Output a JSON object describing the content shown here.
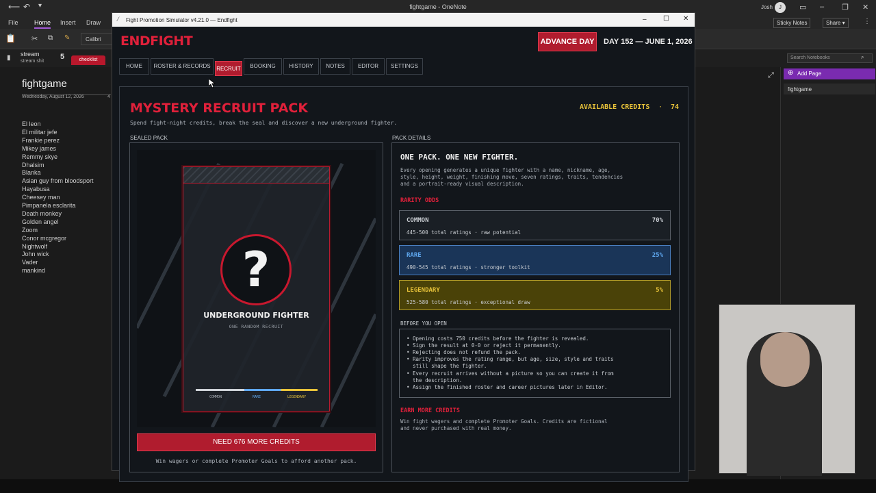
{
  "onenote": {
    "window_title": "fightgame - OneNote",
    "user": "Josh",
    "user_initial": "J",
    "tabs": [
      "File",
      "Home",
      "Insert",
      "Draw"
    ],
    "font_name": "Calibri",
    "section_label": "stream",
    "section_sub": "stream shit",
    "section_num": "5",
    "section_tab": "checklist",
    "page_title": "fightgame",
    "page_date": "Wednesday, August 12, 2026",
    "page_num": "4",
    "list_items": [
      "El leon",
      "El militar jefe",
      "Frankie perez",
      "Mikey james",
      "Remmy skye",
      "Dhalsim",
      "Blanka",
      "Asian guy from bloodsport",
      "Hayabusa",
      "Cheesey man",
      "Pimpanela esclarita",
      "Death monkey",
      "Golden angel",
      "Zoom",
      "Conor mcgregor",
      "Nightwolf",
      "John wick",
      "Vader",
      "mankind"
    ],
    "sticky_notes": "Sticky Notes",
    "share": "Share",
    "search_placeholder": "Search Notebooks",
    "add_page": "Add Page",
    "right_page": "fightgame"
  },
  "game": {
    "window_title": "Fight Promotion Simulator v4.21.0 — Endfight",
    "logo": "ENDFIGHT",
    "advance_day": "ADVANCE DAY",
    "day_label": "DAY 152 — JUNE 1, 2026",
    "nav": [
      "HOME",
      "ROSTER & RECORDS",
      "RECRUIT",
      "BOOKING",
      "HISTORY",
      "NOTES",
      "EDITOR",
      "SETTINGS"
    ],
    "page_title": "MYSTERY RECRUIT PACK",
    "page_subtitle": "Spend fight-night credits, break the seal and discover a new underground fighter.",
    "credits_label": "AVAILABLE CREDITS",
    "credits_sep": "·",
    "credits_value": "74",
    "sealed_pack_label": "SEALED PACK",
    "pack_question": "?",
    "pack_title": "UNDERGROUND FIGHTER",
    "pack_sub": "ONE RANDOM RECRUIT",
    "bar_labels": [
      "COMMON",
      "RARE",
      "LEGENDARY"
    ],
    "need_credits_btn": "NEED 676 MORE CREDITS",
    "need_note": "Win wagers or complete Promoter Goals to afford another pack.",
    "pack_details_label": "PACK DETAILS",
    "details_heading": "ONE PACK. ONE NEW FIGHTER.",
    "details_text": "Every opening generates a unique fighter with a name, nickname, age, style, height, weight, finishing move, seven ratings, traits, tendencies and a portrait-ready visual description.",
    "rarity_heading": "RARITY ODDS",
    "rarity": [
      {
        "name": "COMMON",
        "pct": "70%",
        "desc": "445-500 total ratings  ·  raw potential",
        "color": "#1a1f25",
        "text": "#c9cdd2"
      },
      {
        "name": "RARE",
        "pct": "25%",
        "desc": "490-545 total ratings  ·  stronger toolkit",
        "color": "#1a3558",
        "text": "#5fa8f0"
      },
      {
        "name": "LEGENDARY",
        "pct": "5%",
        "desc": "525-580 total ratings  ·  exceptional draw",
        "color": "#4a4208",
        "text": "#e8c33a"
      }
    ],
    "before_heading": "BEFORE YOU OPEN",
    "before_items": [
      "• Opening costs 750 credits before the fighter is revealed.",
      "• Sign the result at 0-0 or reject it permanently.",
      "• Rejecting does not refund the pack.",
      "• Rarity improves the rating range, but age, size, style and traits",
      "  still shape the fighter.",
      "• Every recruit arrives without a picture so you can create it from",
      "  the description.",
      "• Assign the finished roster and career pictures later in Editor."
    ],
    "earn_heading": "EARN MORE CREDITS",
    "earn_text_1": "Win fight wagers and complete Promoter Goals. Credits are fictional",
    "earn_text_2": "and never purchased with real money."
  }
}
